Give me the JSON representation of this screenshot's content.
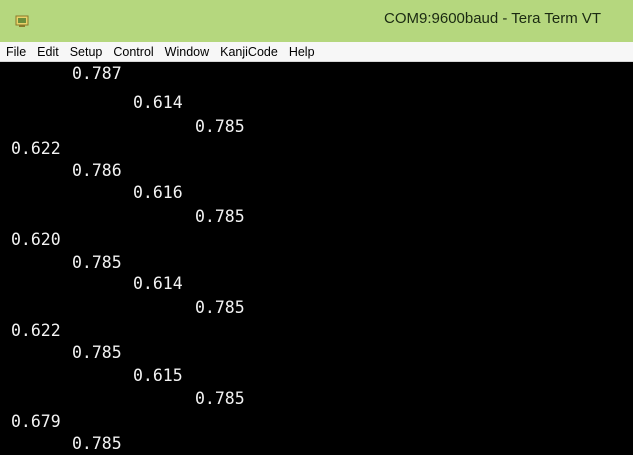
{
  "window": {
    "title": "COM9:9600baud - Tera Term VT"
  },
  "menu": {
    "items": [
      {
        "label": "File"
      },
      {
        "label": "Edit"
      },
      {
        "label": "Setup"
      },
      {
        "label": "Control"
      },
      {
        "label": "Window"
      },
      {
        "label": "KanjiCode"
      },
      {
        "label": "Help"
      }
    ]
  },
  "terminal": {
    "lines": [
      "0.787",
      "0.614",
      "0.785",
      "0.622",
      "0.786",
      "0.616",
      "0.785",
      "0.620",
      "0.785",
      "0.614",
      "0.785",
      "0.622",
      "0.785",
      "0.615",
      "0.785",
      "0.679",
      "0.785"
    ]
  },
  "colors": {
    "titlebar": "#b5d77e",
    "terminal_bg": "#000000",
    "terminal_fg": "#f2f2f2"
  },
  "icons": {
    "app": "tera-term-icon"
  }
}
